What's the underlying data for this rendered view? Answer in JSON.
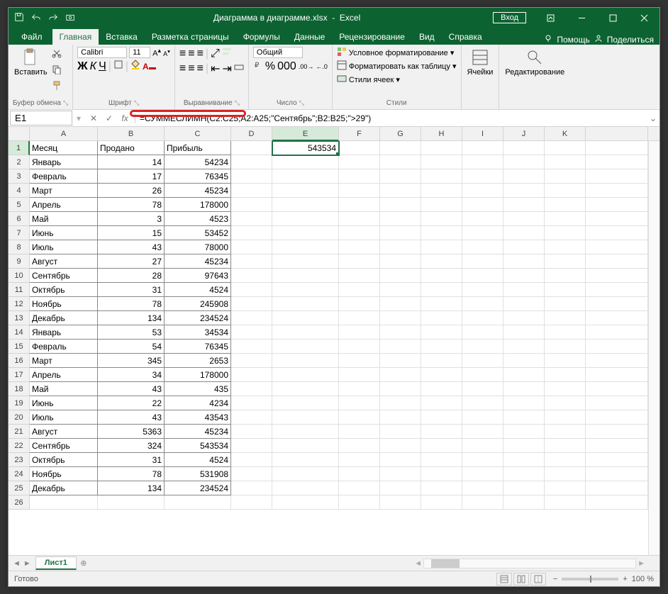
{
  "titlebar": {
    "filename": "Диаграмма в диаграмме.xlsx",
    "appname": "Excel",
    "login": "Вход"
  },
  "tabs": {
    "file": "Файл",
    "items": [
      "Главная",
      "Вставка",
      "Разметка страницы",
      "Формулы",
      "Данные",
      "Рецензирование",
      "Вид",
      "Справка"
    ],
    "active": 0,
    "help": "Помощь",
    "share": "Поделиться"
  },
  "ribbon": {
    "clipboard": {
      "paste": "Вставить",
      "label": "Буфер обмена"
    },
    "font": {
      "name": "Calibri",
      "size": "11",
      "label": "Шрифт",
      "bold": "Ж",
      "italic": "К",
      "underline": "Ч"
    },
    "alignment": {
      "label": "Выравнивание"
    },
    "number": {
      "format": "Общий",
      "label": "Число"
    },
    "styles": {
      "cond": "Условное форматирование",
      "table": "Форматировать как таблицу",
      "cell": "Стили ячеек",
      "label": "Стили"
    },
    "cells": {
      "label": "Ячейки"
    },
    "editing": {
      "label": "Редактирование"
    }
  },
  "formulabar": {
    "namebox": "E1",
    "formula": "=СУММЕСЛИМН(C2:C25;A2:A25;\"Сентябрь\";B2:B25;\">29\")",
    "fx": "fx"
  },
  "sheet": {
    "columns": [
      "A",
      "B",
      "C",
      "D",
      "E",
      "F",
      "G",
      "H",
      "I",
      "J",
      "K"
    ],
    "selected_col": "E",
    "selected_row": 1,
    "e1_value": "543534",
    "headers": [
      "Месяц",
      "Продано",
      "Прибыль"
    ],
    "rows": [
      {
        "n": 1,
        "a": "Месяц",
        "b": "Продано",
        "c": "Прибыль"
      },
      {
        "n": 2,
        "a": "Январь",
        "b": 14,
        "c": 54234
      },
      {
        "n": 3,
        "a": "Февраль",
        "b": 17,
        "c": 76345
      },
      {
        "n": 4,
        "a": "Март",
        "b": 26,
        "c": 45234
      },
      {
        "n": 5,
        "a": "Апрель",
        "b": 78,
        "c": 178000
      },
      {
        "n": 6,
        "a": "Май",
        "b": 3,
        "c": 4523
      },
      {
        "n": 7,
        "a": "Июнь",
        "b": 15,
        "c": 53452
      },
      {
        "n": 8,
        "a": "Июль",
        "b": 43,
        "c": 78000
      },
      {
        "n": 9,
        "a": "Август",
        "b": 27,
        "c": 45234
      },
      {
        "n": 10,
        "a": "Сентябрь",
        "b": 28,
        "c": 97643
      },
      {
        "n": 11,
        "a": "Октябрь",
        "b": 31,
        "c": 4524
      },
      {
        "n": 12,
        "a": "Ноябрь",
        "b": 78,
        "c": 245908
      },
      {
        "n": 13,
        "a": "Декабрь",
        "b": 134,
        "c": 234524
      },
      {
        "n": 14,
        "a": "Январь",
        "b": 53,
        "c": 34534
      },
      {
        "n": 15,
        "a": "Февраль",
        "b": 54,
        "c": 76345
      },
      {
        "n": 16,
        "a": "Март",
        "b": 345,
        "c": 2653
      },
      {
        "n": 17,
        "a": "Апрель",
        "b": 34,
        "c": 178000
      },
      {
        "n": 18,
        "a": "Май",
        "b": 43,
        "c": 435
      },
      {
        "n": 19,
        "a": "Июнь",
        "b": 22,
        "c": 4234
      },
      {
        "n": 20,
        "a": "Июль",
        "b": 43,
        "c": 43543
      },
      {
        "n": 21,
        "a": "Август",
        "b": 5363,
        "c": 45234
      },
      {
        "n": 22,
        "a": "Сентябрь",
        "b": 324,
        "c": 543534
      },
      {
        "n": 23,
        "a": "Октябрь",
        "b": 31,
        "c": 4524
      },
      {
        "n": 24,
        "a": "Ноябрь",
        "b": 78,
        "c": 531908
      },
      {
        "n": 25,
        "a": "Декабрь",
        "b": 134,
        "c": 234524
      }
    ]
  },
  "sheettabs": {
    "active": "Лист1"
  },
  "status": {
    "ready": "Готово",
    "zoom": "100 %"
  }
}
